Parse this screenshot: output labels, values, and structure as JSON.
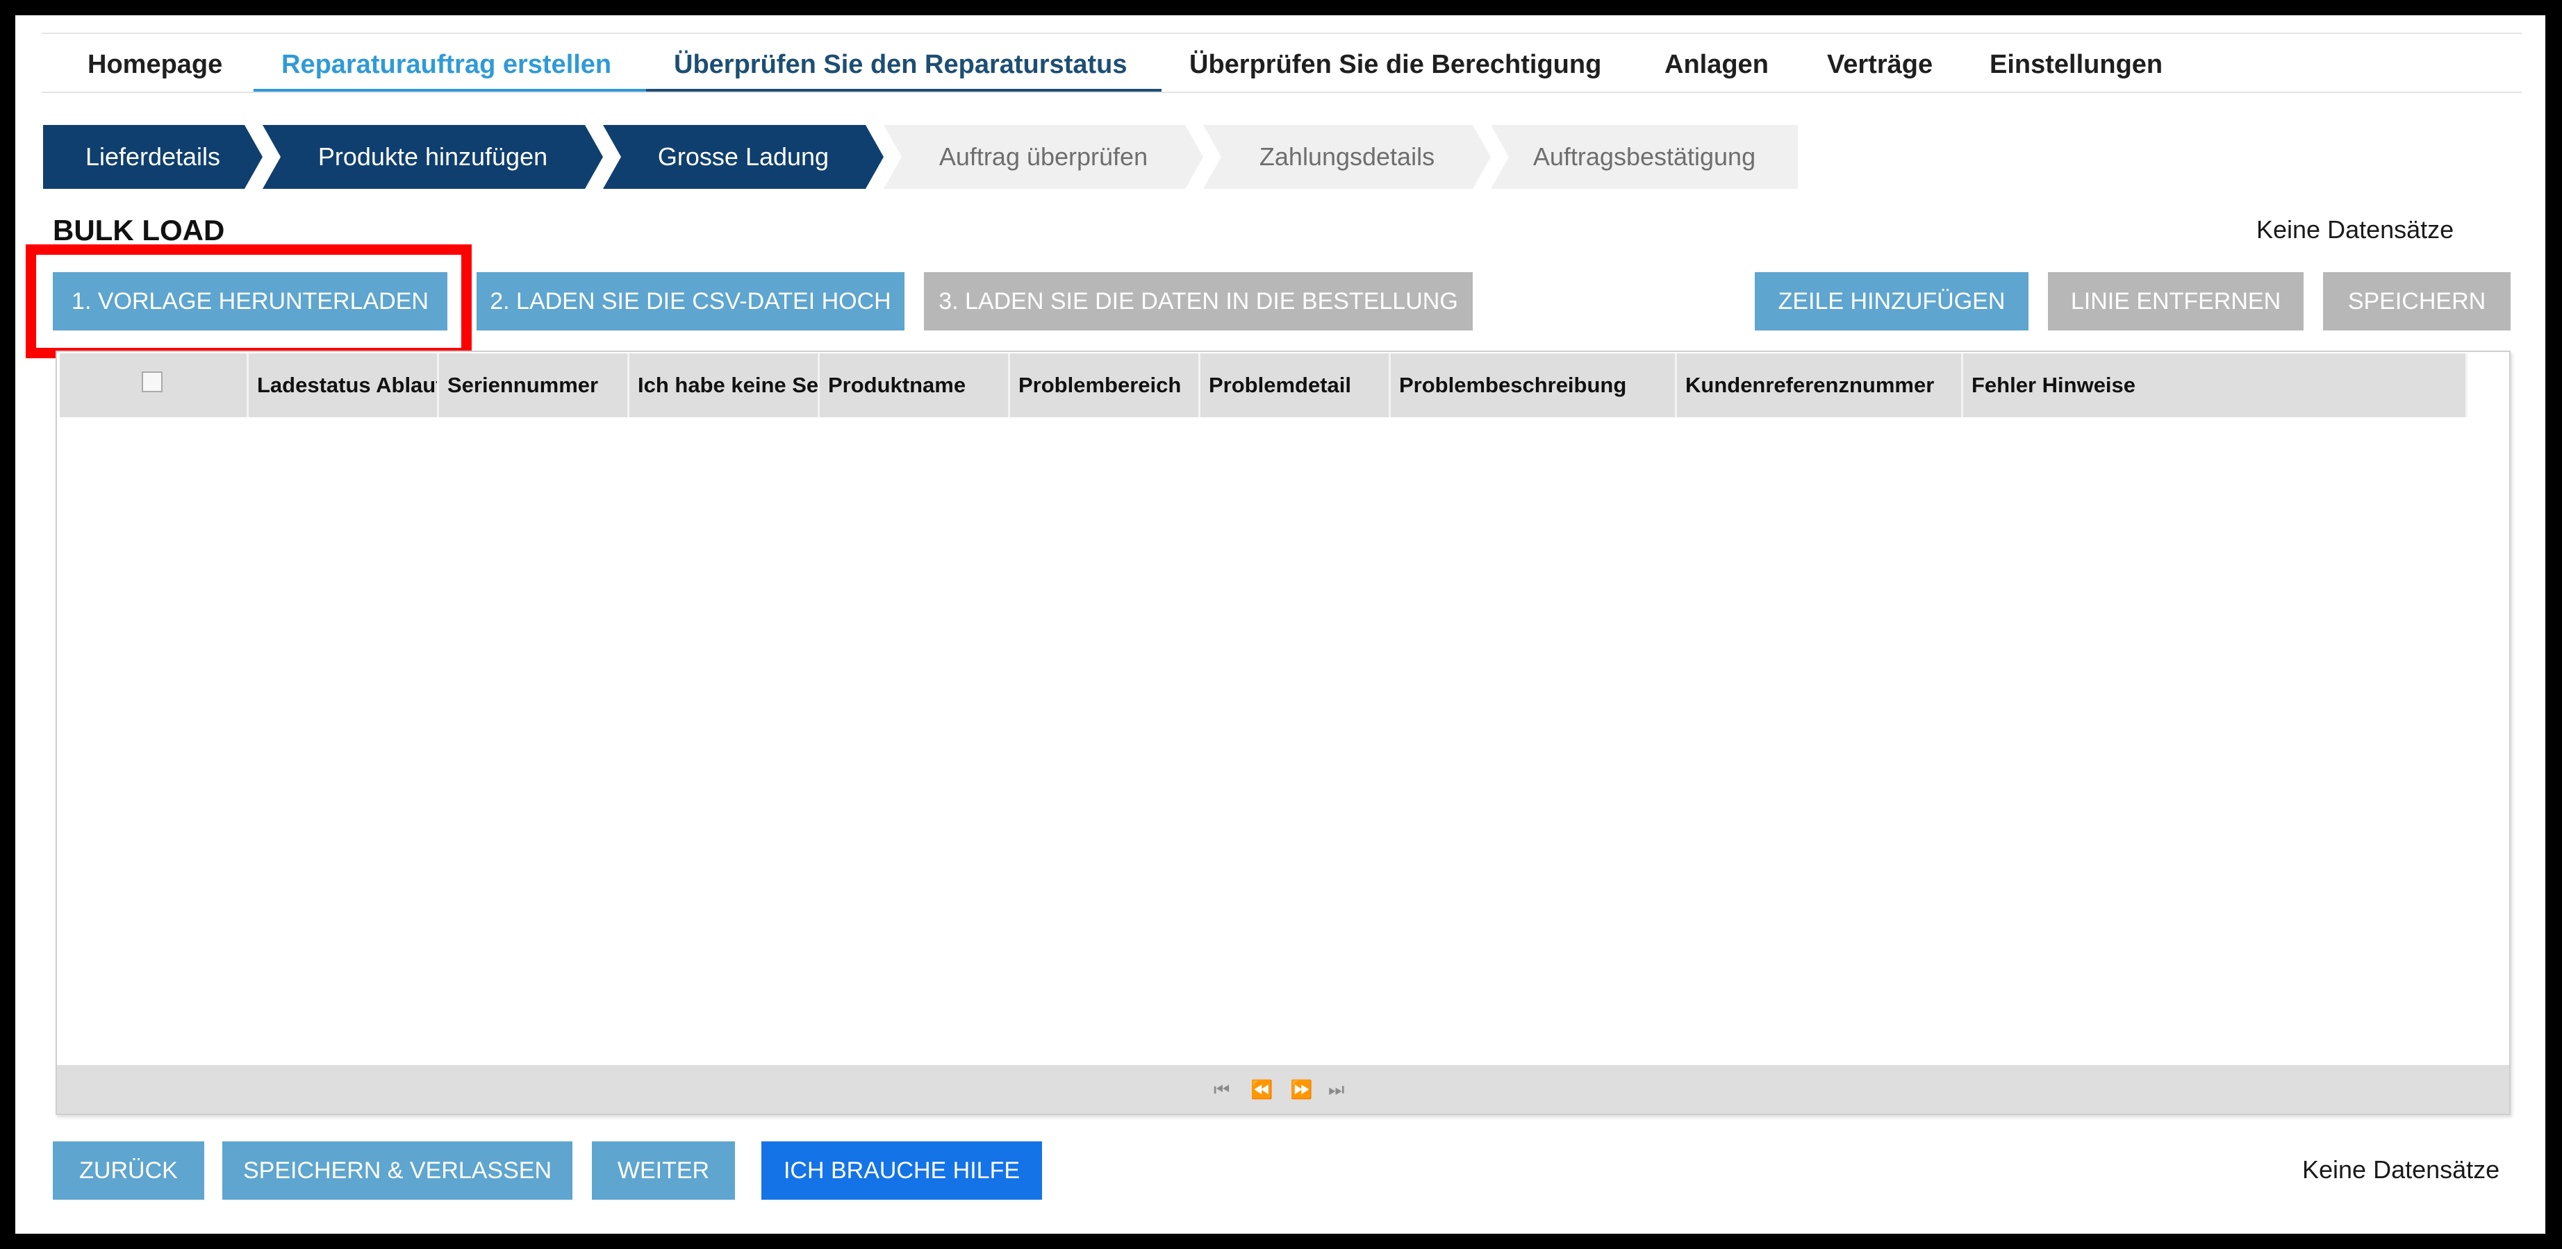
{
  "nav": {
    "items": [
      {
        "label": "Homepage"
      },
      {
        "label": "Reparaturauftrag erstellen"
      },
      {
        "label": "Überprüfen Sie den Reparaturstatus"
      },
      {
        "label": "Überprüfen Sie die Berechtigung"
      },
      {
        "label": "Anlagen"
      },
      {
        "label": "Verträge"
      },
      {
        "label": "Einstellungen"
      }
    ],
    "active_color": "#2f9ad8"
  },
  "steps": [
    {
      "label": "Lieferdetails",
      "state": "done"
    },
    {
      "label": "Produkte hinzufügen",
      "state": "done"
    },
    {
      "label": "Grosse Ladung",
      "state": "done"
    },
    {
      "label": "Auftrag überprüfen",
      "state": "todo"
    },
    {
      "label": "Zahlungsdetails",
      "state": "todo"
    },
    {
      "label": "Auftragsbestätigung",
      "state": "todo"
    }
  ],
  "colors": {
    "step_done": "#0f3f6e",
    "step_todo": "#f0f0f0",
    "highlight": "#ff0000"
  },
  "section": {
    "title": "BULK LOAD",
    "records_top": "Keine Datensätze"
  },
  "actions": {
    "download_template": "1. VORLAGE HERUNTERLADEN",
    "upload_csv": "2. LADEN SIE DIE CSV-DATEI HOCH",
    "load_data": "3. LADEN SIE DIE DATEN IN DIE BESTELLUNG",
    "add_row": "ZEILE HINZUFÜGEN",
    "remove_line": "LINIE ENTFERNEN",
    "save": "SPEICHERN"
  },
  "table": {
    "columns": [
      "Ladestatus Ablauf",
      "Seriennummer",
      "Ich habe keine Ser",
      "Produktname",
      "Problembereich",
      "Problemdetail",
      "Problembeschreibung",
      "Kundenreferenznummer",
      "Fehler Hinweise"
    ],
    "rows": [],
    "pager": {
      "first": "⏮",
      "prev": "⏪",
      "next": "⏩",
      "last": "⏭"
    }
  },
  "footer": {
    "back": "ZURÜCK",
    "save_exit": "SPEICHERN & VERLASSEN",
    "next": "WEITER",
    "help": "ICH BRAUCHE HILFE",
    "records_bottom": "Keine Datensätze"
  }
}
